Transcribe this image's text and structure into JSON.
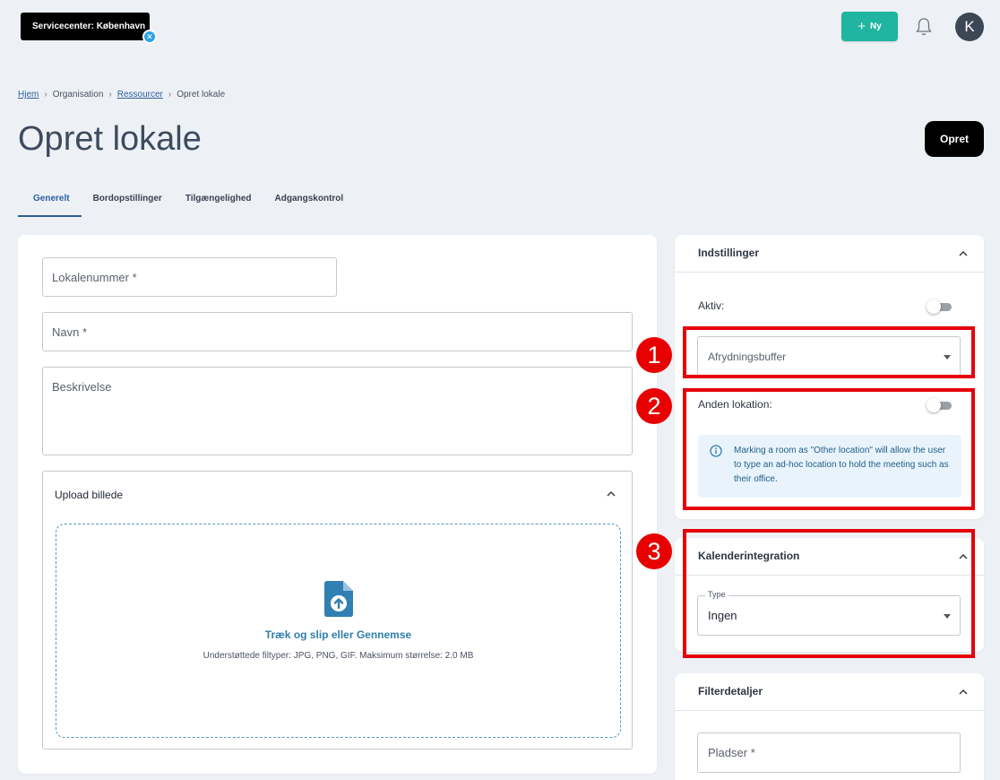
{
  "header": {
    "site_badge": "Servicecenter: København",
    "new_button": "Ny",
    "avatar_letter": "K"
  },
  "breadcrumb": [
    "Hjem",
    "Organisation",
    "Ressourcer",
    "Opret lokale"
  ],
  "page": {
    "title": "Opret lokale",
    "create_button": "Opret"
  },
  "tabs": [
    "Generelt",
    "Bordopstillinger",
    "Tilgængelighed",
    "Adgangskontrol"
  ],
  "form": {
    "lokalenummer_placeholder": "Lokalenummer *",
    "navn_placeholder": "Navn *",
    "beskrivelse_placeholder": "Beskrivelse"
  },
  "upload": {
    "title": "Upload billede",
    "drop_text": "Træk og slip eller Gennemse",
    "sub_text": "Understøttede filtyper: JPG, PNG, GIF. Maksimum størrelse: 2.0 MB"
  },
  "indstillinger": {
    "title": "Indstillinger",
    "aktiv_label": "Aktiv:",
    "aktiv_on": false,
    "afrydning_placeholder": "Afrydningsbuffer",
    "anden_lokation_label": "Anden lokation:",
    "anden_lokation_on": false,
    "info_text": "Marking a room as \"Other location\" will allow the user to type an ad-hoc location to hold the meeting such as their office."
  },
  "kalender": {
    "title": "Kalenderintegration",
    "type_label": "Type",
    "type_value": "Ingen"
  },
  "filter": {
    "title": "Filterdetaljer",
    "pladser_placeholder": "Pladser *"
  },
  "annotations": [
    "1",
    "2",
    "3"
  ],
  "colors": {
    "accent": "#2c5f9e",
    "new_button": "#1fb5a0",
    "annotation_red": "#e5000a"
  }
}
